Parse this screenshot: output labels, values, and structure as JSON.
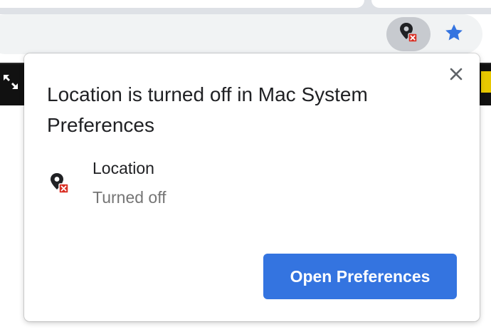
{
  "toolbar": {
    "location_icon": "location-blocked-icon",
    "bookmark_icon": "star-icon",
    "star_color": "#3474e0"
  },
  "page": {
    "expand_icon": "expand-icon"
  },
  "bubble": {
    "title": "Location is turned off in Mac System Preferences",
    "close_icon": "close-icon",
    "permission": {
      "icon": "location-blocked-icon",
      "label": "Location",
      "status": "Turned off"
    },
    "primary_button": "Open Preferences",
    "primary_color": "#3474e0",
    "blocked_badge_color": "#d93025"
  }
}
